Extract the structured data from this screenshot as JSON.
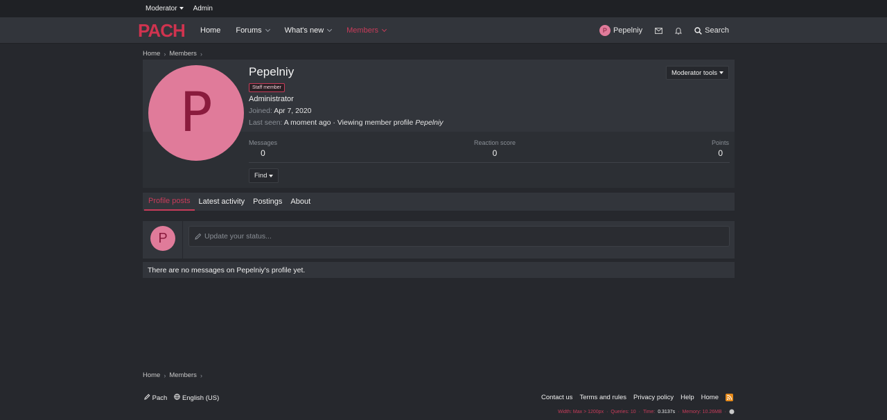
{
  "admin_bar": {
    "moderator": "Moderator",
    "admin": "Admin"
  },
  "nav": {
    "logo_text": "PACH",
    "home": "Home",
    "forums": "Forums",
    "whats_new": "What's new",
    "members": "Members",
    "user": "Pepelniy",
    "user_initial": "P",
    "search": "Search"
  },
  "breadcrumb": {
    "home": "Home",
    "members": "Members"
  },
  "profile": {
    "initial": "P",
    "name": "Pepelniy",
    "badge": "Staff member",
    "role": "Administrator",
    "joined_label": "Joined:",
    "joined_value": "Apr 7, 2020",
    "last_seen_label": "Last seen:",
    "last_seen_value": "A moment ago · Viewing member profile",
    "last_seen_target": "Pepelniy",
    "mod_tools": "Moderator tools",
    "stats": {
      "messages_label": "Messages",
      "messages": "0",
      "reaction_label": "Reaction score",
      "reaction": "0",
      "points_label": "Points",
      "points": "0"
    },
    "find": "Find"
  },
  "tabs": [
    "Profile posts",
    "Latest activity",
    "Postings",
    "About"
  ],
  "status": {
    "placeholder": "Update your status..."
  },
  "empty_message": "There are no messages on Pepelniy's profile yet.",
  "footer": {
    "style": "Pach",
    "language": "English (US)",
    "links": [
      "Contact us",
      "Terms and rules",
      "Privacy policy",
      "Help",
      "Home"
    ],
    "debug": {
      "width": "Width: Max > 1200px",
      "queries": "Queries: 10",
      "time_label": "Time:",
      "time": "0.3137s",
      "memory": "Memory: 10.26MB"
    }
  },
  "colors": {
    "accent": "#c83c5a",
    "avatar_bg": "#e07b9a",
    "bg": "#26282d",
    "panel": "#32353b"
  }
}
